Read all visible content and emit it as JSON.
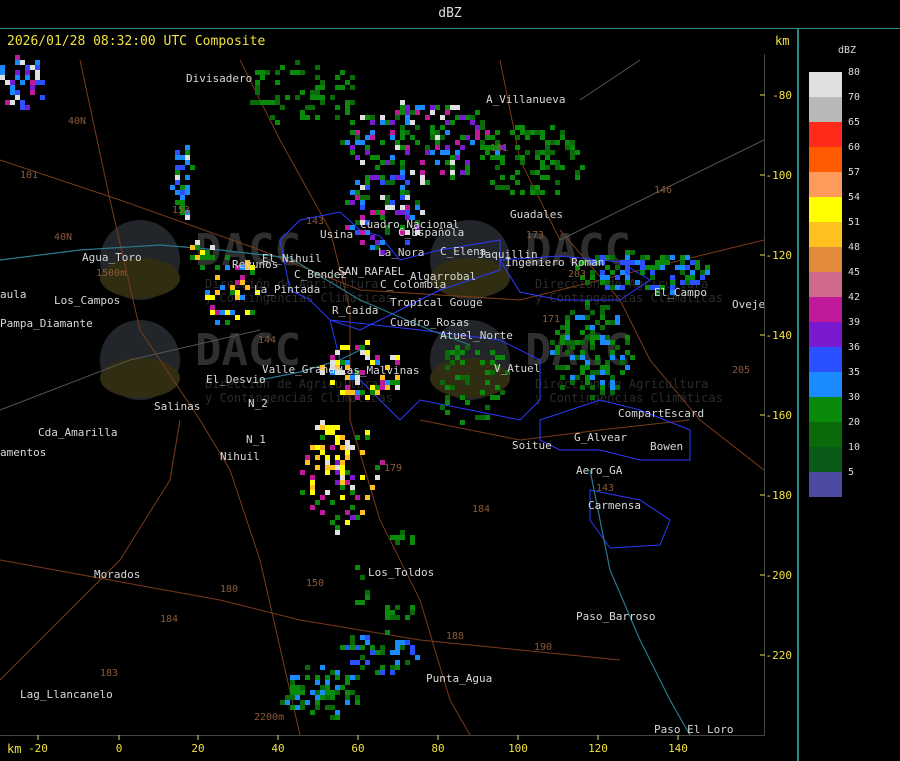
{
  "window": {
    "title": "dBZ"
  },
  "header": {
    "timestamp": "2026/01/28 08:32:00 UTC Composite",
    "unit_top": "km",
    "unit_bottom": "km"
  },
  "legend": {
    "title": "dBZ",
    "levels": [
      {
        "value": "80",
        "color": "#e0e0e0"
      },
      {
        "value": "70",
        "color": "#b8b8b8"
      },
      {
        "value": "65",
        "color": "#ff2a1a"
      },
      {
        "value": "60",
        "color": "#ff5a00"
      },
      {
        "value": "57",
        "color": "#ff9a5a"
      },
      {
        "value": "54",
        "color": "#ffff00"
      },
      {
        "value": "51",
        "color": "#ffc020"
      },
      {
        "value": "48",
        "color": "#e08a3a"
      },
      {
        "value": "45",
        "color": "#d06a8a"
      },
      {
        "value": "42",
        "color": "#c01a9a"
      },
      {
        "value": "39",
        "color": "#7a1ad0"
      },
      {
        "value": "36",
        "color": "#2a50ff"
      },
      {
        "value": "35",
        "color": "#1a8aff"
      },
      {
        "value": "30",
        "color": "#0a8a0a"
      },
      {
        "value": "20",
        "color": "#0a6a0a"
      },
      {
        "value": "10",
        "color": "#0a5a1a"
      },
      {
        "value": "5",
        "color": "#4a4aa0"
      }
    ]
  },
  "axes": {
    "x_ticks": [
      "-20",
      "0",
      "20",
      "40",
      "60",
      "80",
      "100",
      "120",
      "140"
    ],
    "y_ticks": [
      "-80",
      "-100",
      "-120",
      "-140",
      "-160",
      "-180",
      "-200",
      "-220"
    ]
  },
  "places": [
    "Divisadero",
    "A_Villanueva",
    "Guadales",
    "Usina",
    "C_Española",
    "La_Nora",
    "Cuadro_Nacional",
    "C_Elena",
    "Jaquillin",
    "Ingeniero Roman",
    "Agua_Toro",
    "Reyunos",
    "El_Nihuil",
    "C_Bendez",
    "SAN_RAFAEL",
    "Algarrobal",
    "C_Colombia",
    "La_Pintada",
    "Tropical Gouge",
    "R_Caida",
    "Cuadro_Rosas",
    "Atuel_Norte",
    "Valle_Grande",
    "Las_Malvinas",
    "El_Desvio",
    "V_Atuel",
    "Salinas",
    "N_2",
    "N_1",
    "Nihuil",
    "Soitue",
    "G_Alvear",
    "CompartEscard",
    "Bowen",
    "Aero_GA",
    "Carmensa",
    "Morados",
    "Los_Toldos",
    "Paso_Barroso",
    "Punta_Agua",
    "Lag_Llancanelo",
    "Cda_Amarilla",
    "amentos",
    "Pampa_Diamante",
    "aula",
    "El_Campo",
    "Ovejer",
    "Paso_El_Loro",
    "Los_Campos"
  ],
  "route_labels": [
    "101",
    "40N",
    "40N",
    "143",
    "144",
    "171",
    "173",
    "181",
    "179",
    "180",
    "184",
    "184",
    "183",
    "188",
    "190",
    "203",
    "146",
    "205",
    "143",
    "153",
    "150",
    "1500m",
    "2200m"
  ],
  "watermark": [
    "DACC",
    "Dirección de Agricultura",
    "y Contingencias Climáticas"
  ],
  "icons": [
    "radar-reflectivity-cells",
    "district-boundary-lines",
    "road-lines",
    "river-lines"
  ]
}
